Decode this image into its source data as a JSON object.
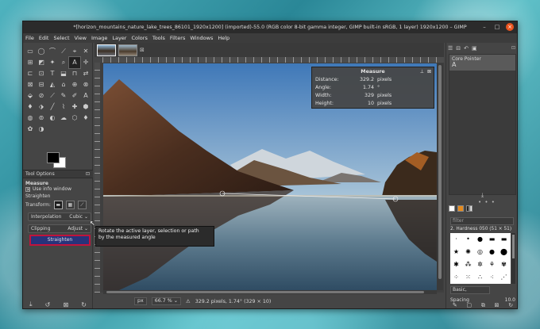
{
  "window": {
    "title": "*[horizon_mountains_nature_lake_trees_86101_1920x1200] (imported)-55.0 (RGB color 8-bit gamma integer, GIMP built-in sRGB, 1 layer) 1920x1200 – GIMP",
    "minimize": "–",
    "maximize": "□",
    "close": "×"
  },
  "menu": [
    "File",
    "Edit",
    "Select",
    "View",
    "Image",
    "Layer",
    "Colors",
    "Tools",
    "Filters",
    "Windows",
    "Help"
  ],
  "toolbox": {
    "tools": [
      "▭",
      "◯",
      "⌒",
      "⟋",
      "⌖",
      "✕",
      "⊞",
      "◩",
      "✦",
      "⌕",
      "A",
      "✛",
      "⊏",
      "⊡",
      "T",
      "⬓",
      "⊓",
      "⇄",
      "⊠",
      "⊟",
      "◭",
      "⌂",
      "⊕",
      "⊗",
      "⬙",
      "⊘",
      "⟋",
      "✎",
      "✐",
      "A",
      "♦",
      "⬗",
      "╱",
      "⌇",
      "✚",
      "⬢",
      "◍",
      "⊚",
      "◐",
      "☁",
      "⬡",
      "♦",
      "✿",
      "◑"
    ],
    "active_tool_index": 10
  },
  "tool_options": {
    "tab_label": "Tool Options",
    "tool_name": "Measure",
    "use_info_window_label": "Use info window",
    "use_info_window_checked": true,
    "straighten_label": "Straighten",
    "transform_label": "Transform:",
    "interpolation_label": "Interpolation",
    "interpolation_value": "Cubic",
    "clipping_label": "Clipping",
    "clipping_value": "Adjust",
    "straighten_button": "Straighten"
  },
  "tooltip": {
    "line1": "Rotate the active layer, selection or path",
    "line2": "by the measured angle"
  },
  "measure": {
    "title": "Measure",
    "distance_label": "Distance:",
    "distance_value": "329.2",
    "distance_unit": "pixels",
    "angle_label": "Angle:",
    "angle_value": "1.74",
    "angle_unit": "°",
    "width_label": "Width:",
    "width_value": "329",
    "width_unit": "pixels",
    "height_label": "Height:",
    "height_value": "10",
    "height_unit": "pixels"
  },
  "statusbar": {
    "unit": "px",
    "zoom": "66.7 %",
    "message": "329.2 pixels, 1.74° (329 × 10)"
  },
  "right_panel": {
    "device_label": "Core Pointer",
    "brush_filter_placeholder": "filter",
    "brush_name": "2. Hardness 050 (51 × 51)",
    "brush_preset": "Basic,",
    "spacing_label": "Spacing",
    "spacing_value": "10.0"
  },
  "colors": {
    "accent_border": "#c0143c",
    "straighten_bg": "#28337a",
    "foreground": "#000000",
    "background": "#ffffff"
  }
}
